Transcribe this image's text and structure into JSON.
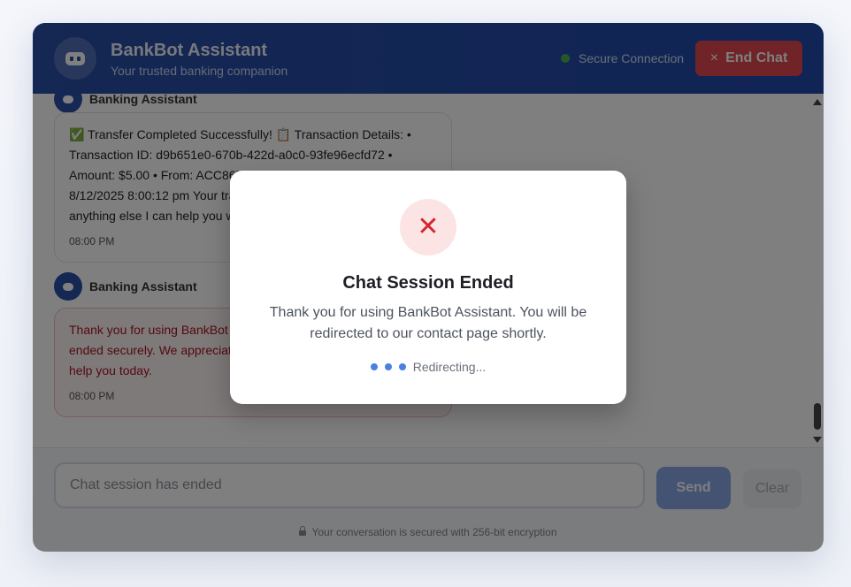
{
  "header": {
    "title": "BankBot Assistant",
    "subtitle": "Your trusted banking companion",
    "status": "Secure Connection",
    "end_chat_label": "End Chat",
    "end_chat_icon": "×"
  },
  "messages": [
    {
      "sender": "Banking Assistant",
      "text": "✅ Transfer Completed Successfully! 📋 Transaction Details: • Transaction ID: d9b651e0-670b-422d-a0c0-93fe96ecfd72 • Amount: $5.00 • From: ACC867879 • To: ACC8980 • Date: 8/12/2025 8:00:12 pm Your transfer has been processed. Is there anything else I can help you with?",
      "time": "08:00 PM"
    },
    {
      "sender": "Banking Assistant",
      "text": "Thank you for using BankBot Assistant. Your session has been ended securely. We appreciate your trust in us and were happy to help you today.",
      "time": "08:00 PM"
    }
  ],
  "input": {
    "placeholder": "Chat session has ended",
    "send_label": "Send",
    "clear_label": "Clear"
  },
  "footer": {
    "encryption_note": "Your conversation is secured with 256-bit encryption"
  },
  "modal": {
    "icon": "✕",
    "title": "Chat Session Ended",
    "message": "Thank you for using BankBot Assistant. You will be redirected to our contact page shortly.",
    "redirecting": "Redirecting..."
  },
  "colors": {
    "header": "#2a4fa6",
    "end_chat": "#e0484f",
    "status_dot": "#4caf50",
    "modal_icon": "#d6252c",
    "dots": "#4a80df"
  }
}
